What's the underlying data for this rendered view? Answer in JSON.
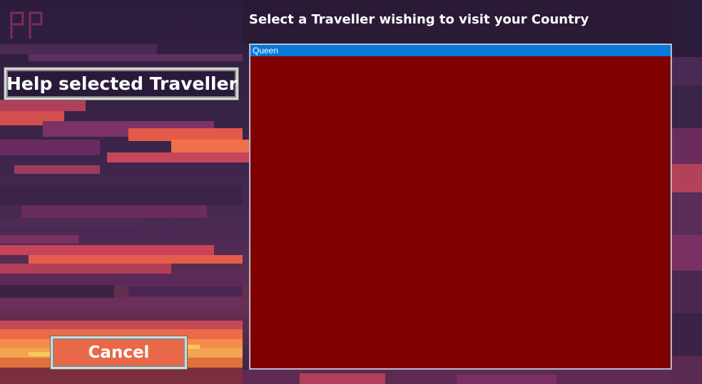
{
  "logo_text": "PP",
  "prompt": "Select a Traveller wishing to visit your Country",
  "buttons": {
    "help_label": "Help selected Traveller",
    "cancel_label": "Cancel"
  },
  "travellers": [
    {
      "name": "Queen",
      "selected": true
    }
  ],
  "colors": {
    "list_background": "#800000",
    "selection": "#0a78d8",
    "cancel_background": "#e86848",
    "help_background": "#2a1a3a"
  }
}
